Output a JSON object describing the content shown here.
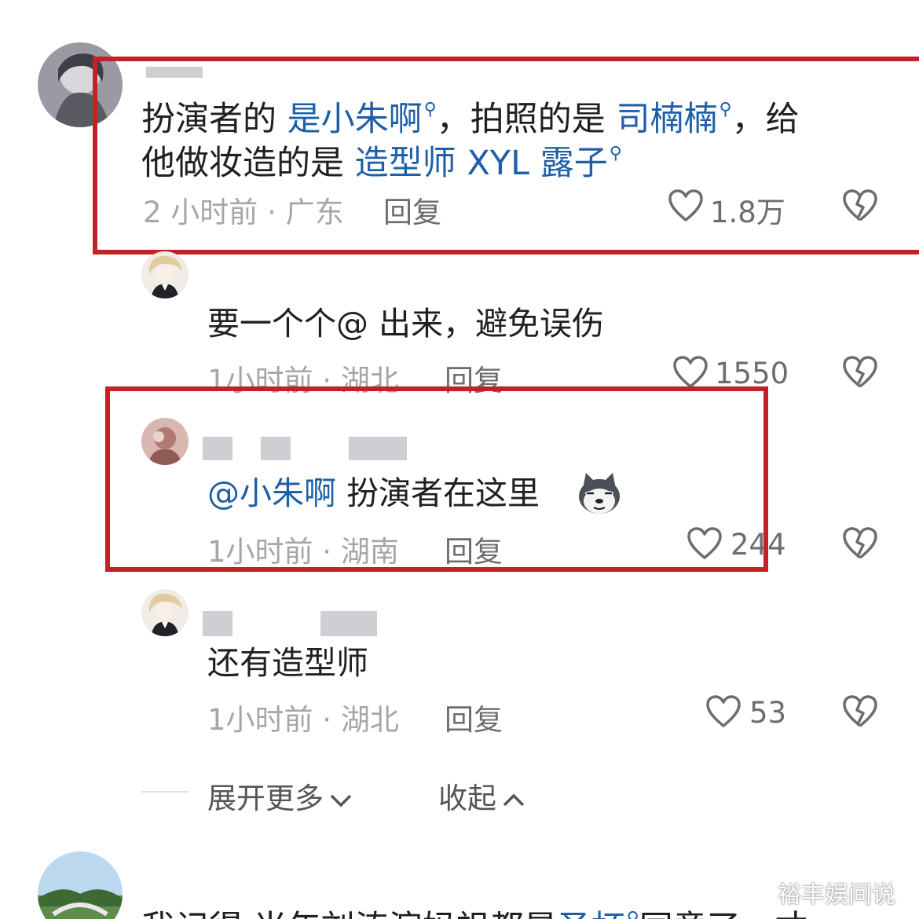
{
  "comments": [
    {
      "parts": [
        {
          "text": "扮演者的 ",
          "kind": "plain"
        },
        {
          "text": "是小朱啊",
          "kind": "link"
        },
        {
          "text": "，拍照的是 ",
          "kind": "plain"
        },
        {
          "text": "司楠楠",
          "kind": "link"
        },
        {
          "text": "，给",
          "kind": "plain"
        }
      ],
      "line2_parts": [
        {
          "text": "他做妆造的是 ",
          "kind": "plain"
        },
        {
          "text": "造型师 XYL 露子",
          "kind": "link"
        }
      ],
      "meta": "2 小时前 · 广东",
      "reply": "回复",
      "likes": "1.8万"
    },
    {
      "text": "要一个个@ 出来，避免误伤",
      "meta": "1小时前 · 湖北",
      "reply": "回复",
      "likes": "1550"
    },
    {
      "mention": "@小朱啊",
      "text": " 扮演者在这里",
      "emoji": "dog-face-emoji",
      "meta": "1小时前 · 湖南",
      "reply": "回复",
      "likes": "244"
    },
    {
      "text": "还有造型师",
      "meta": "1小时前 · 湖北",
      "reply": "回复",
      "likes": "53"
    }
  ],
  "expand": {
    "more_label": "展开更多",
    "collapse_label": "收起"
  },
  "next_comment": {
    "partial_text": "我记得 当年刘涛演妈祖都是",
    "link": "圣杯",
    "partial_tail": "同意了，才"
  },
  "watermark": "裕丰娱间说",
  "colors": {
    "link": "#1f5fa8",
    "highlight": "#c62027",
    "meta": "#a6a6a6"
  },
  "icons": [
    "heart-icon",
    "broken-heart-icon",
    "search-small-icon",
    "chevron-down-icon",
    "chevron-up-icon"
  ]
}
